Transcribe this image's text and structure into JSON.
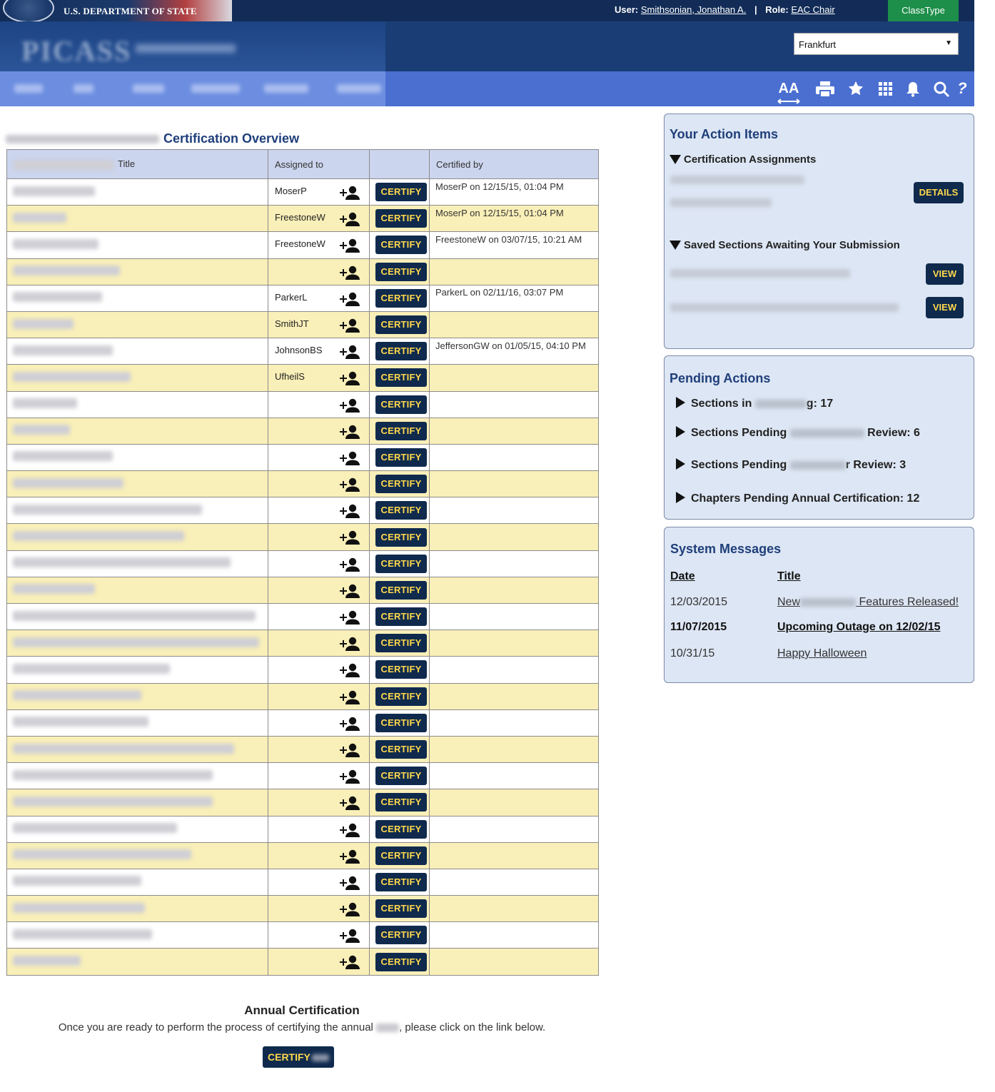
{
  "header": {
    "agency": "U.S. DEPARTMENT OF STATE",
    "user_label": "User:",
    "user_name": "Smithsonian, Jonathan A.",
    "separator": "|",
    "role_label": "Role:",
    "role_name": "EAC Chair",
    "classtype": "ClassType",
    "post_selected": "Frankfurt",
    "post_arrow": "▼"
  },
  "toolbar": {
    "icons": [
      "text-size-icon",
      "print-icon",
      "favorite-icon",
      "apps-grid-icon",
      "notifications-icon",
      "search-icon",
      "help-icon"
    ],
    "text_size": "AA",
    "help": "?"
  },
  "certification": {
    "heading": "Certification Overview",
    "columns": {
      "title": "Title",
      "assigned": "Assigned to",
      "action": "",
      "certified": "Certified by"
    },
    "button_label": "CERTIFY",
    "rows": [
      {
        "assigned": "MoserP",
        "certified": "MoserP on 12/15/15, 01:04 PM",
        "blur": 115
      },
      {
        "assigned": "FreestoneW",
        "certified": "MoserP on 12/15/15, 01:04 PM",
        "blur": 75
      },
      {
        "assigned": "FreestoneW",
        "certified": "FreestoneW on 03/07/15, 10:21 AM",
        "blur": 120
      },
      {
        "assigned": "",
        "certified": "",
        "blur": 150
      },
      {
        "assigned": "ParkerL",
        "certified": "ParkerL on 02/11/16, 03:07 PM",
        "blur": 125
      },
      {
        "assigned": "SmithJT",
        "certified": "",
        "blur": 85
      },
      {
        "assigned": "JohnsonBS",
        "certified": "JeffersonGW on 01/05/15, 04:10 PM",
        "blur": 140
      },
      {
        "assigned": "UfheilS",
        "certified": "",
        "blur": 165
      },
      {
        "assigned": "",
        "certified": "",
        "blur": 90
      },
      {
        "assigned": "",
        "certified": "",
        "blur": 80
      },
      {
        "assigned": "",
        "certified": "",
        "blur": 140
      },
      {
        "assigned": "",
        "certified": "",
        "blur": 155
      },
      {
        "assigned": "",
        "certified": "",
        "blur": 265
      },
      {
        "assigned": "",
        "certified": "",
        "blur": 240
      },
      {
        "assigned": "",
        "certified": "",
        "blur": 305
      },
      {
        "assigned": "",
        "certified": "",
        "blur": 115
      },
      {
        "assigned": "",
        "certified": "",
        "blur": 340
      },
      {
        "assigned": "",
        "certified": "",
        "blur": 345
      },
      {
        "assigned": "",
        "certified": "",
        "blur": 220
      },
      {
        "assigned": "",
        "certified": "",
        "blur": 180
      },
      {
        "assigned": "",
        "certified": "",
        "blur": 190
      },
      {
        "assigned": "",
        "certified": "",
        "blur": 310
      },
      {
        "assigned": "",
        "certified": "",
        "blur": 280
      },
      {
        "assigned": "",
        "certified": "",
        "blur": 280
      },
      {
        "assigned": "",
        "certified": "",
        "blur": 230
      },
      {
        "assigned": "",
        "certified": "",
        "blur": 250
      },
      {
        "assigned": "",
        "certified": "",
        "blur": 180
      },
      {
        "assigned": "",
        "certified": "",
        "blur": 185
      },
      {
        "assigned": "",
        "certified": "",
        "blur": 195
      },
      {
        "assigned": "",
        "certified": "",
        "blur": 95
      }
    ]
  },
  "annual": {
    "title": "Annual Certification",
    "text_before": "Once you are ready to perform the process of certifying the annual ",
    "text_after": ", please click on the link below.",
    "button_label": "CERTIFY"
  },
  "action_items": {
    "title": "Your Action Items",
    "cert_assignments": "Certification Assignments",
    "details_label": "DETAILS",
    "saved_sections": "Saved Sections Awaiting Your Submission",
    "view_label": "VIEW",
    "view_label_2": "VIEW"
  },
  "pending": {
    "title": "Pending Actions",
    "item1_a": "Sections in ",
    "item1_b": "g: 17",
    "item2_a": "Sections Pending ",
    "item2_b": " Review: 6",
    "item3_a": "Sections Pending ",
    "item3_b": "r Review: 3",
    "item4": "Chapters Pending Annual Certification: 12"
  },
  "messages": {
    "title": "System Messages",
    "date_header": "Date",
    "title_header": "Title",
    "m1_date": "12/03/2015",
    "m1_title_a": "New",
    "m1_title_b": " Features Released!",
    "m2_date": "11/07/2015",
    "m2_title": "Upcoming Outage on 12/02/15",
    "m3_date": "10/31/15",
    "m3_title": "Happy Halloween"
  }
}
